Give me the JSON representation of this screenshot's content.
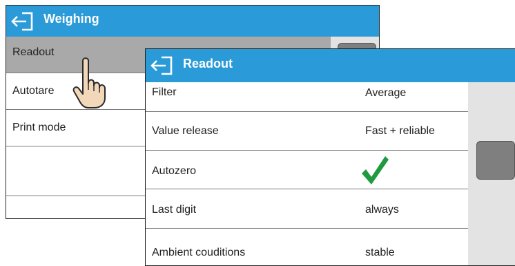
{
  "back_window": {
    "title": "Weighing",
    "items": [
      {
        "label": "Readout"
      },
      {
        "label": "Autotare"
      },
      {
        "label": "Print mode"
      }
    ]
  },
  "front_window": {
    "title": "Readout",
    "rows": [
      {
        "label": "Filter",
        "value": "Average"
      },
      {
        "label": "Value release",
        "value": "Fast + reliable"
      },
      {
        "label": "Autozero",
        "value_icon": "green-check-icon"
      },
      {
        "label": "Last digit",
        "value": "always"
      },
      {
        "label": "Ambient couditions",
        "value": "stable"
      }
    ]
  },
  "icons": {
    "back": "back-arrow-icon",
    "pointer": "pointing-hand-icon"
  },
  "colors": {
    "titlebar": "#2b9ad8",
    "selected_row": "#a9a9a9",
    "scroll_track": "#e3e3e3",
    "scroll_thumb": "#7f7f7f",
    "check": "#1f9a3f"
  }
}
